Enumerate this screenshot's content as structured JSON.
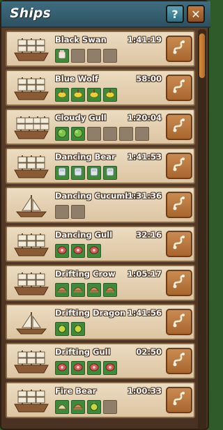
{
  "window": {
    "title": "Ships",
    "help_label": "?",
    "close_label": "✕"
  },
  "colors": {
    "title_bar": "#3f6e80",
    "row_bg": "#e6d3b6",
    "slot_full": "#3f8a3a",
    "slot_empty": "#8f7e69",
    "route_button": "#b87438"
  },
  "ships": [
    {
      "name": "Black Swan",
      "time": "1:41:19",
      "ship_icon": "galleon-icon",
      "slots": [
        "flour-icon",
        "",
        "",
        ""
      ]
    },
    {
      "name": "Blue Wolf",
      "time": "58:00",
      "ship_icon": "galleon-icon",
      "slots": [
        "lemon-icon",
        "lemon-icon",
        "lemon-icon",
        "lemon-icon"
      ]
    },
    {
      "name": "Cloudy Gull",
      "time": "1:20:04",
      "ship_icon": "large-galleon-icon",
      "slots": [
        "herb-icon",
        "herb-icon",
        "",
        "",
        "",
        ""
      ]
    },
    {
      "name": "Dancing Bear",
      "time": "1:41:53",
      "ship_icon": "galleon-icon",
      "slots": [
        "milk-icon",
        "milk-icon",
        "milk-icon",
        "milk-icon"
      ]
    },
    {
      "name": "Dancing Cucumber",
      "time": "1:31:36",
      "ship_icon": "sailboat-icon",
      "slots": [
        "",
        ""
      ]
    },
    {
      "name": "Dancing Gull",
      "time": "32:16",
      "ship_icon": "galleon-icon",
      "slots": [
        "meat-icon",
        "meat-icon",
        "meat-icon"
      ]
    },
    {
      "name": "Drifting Crow",
      "time": "1:05:17",
      "ship_icon": "galleon-icon",
      "slots": [
        "bread-icon",
        "bread-icon",
        "bread-icon",
        "bread-icon"
      ]
    },
    {
      "name": "Drifting Dragon",
      "time": "1:41:56",
      "ship_icon": "sailboat-icon",
      "slots": [
        "potion-icon",
        "potion-icon"
      ]
    },
    {
      "name": "Drifting Gull",
      "time": "02:50",
      "ship_icon": "galleon-icon",
      "slots": [
        "meat-icon",
        "meat-icon",
        "meat-icon",
        "meat-icon"
      ]
    },
    {
      "name": "Fire Bear",
      "time": "1:00:33",
      "ship_icon": "galleon-icon",
      "slots": [
        "shell-icon",
        "bread-icon",
        "potion-icon",
        ""
      ]
    }
  ]
}
